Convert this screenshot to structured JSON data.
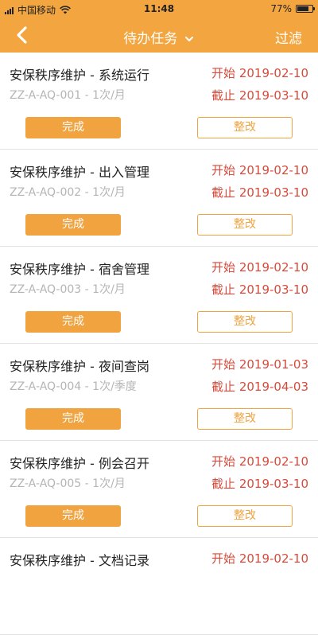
{
  "status_bar": {
    "carrier": "中国移动",
    "time": "11:48",
    "battery_text": "77%",
    "battery_level": 0.77
  },
  "navbar": {
    "title": "待办任务",
    "filter_label": "过滤"
  },
  "colors": {
    "accent": "#f3a640",
    "date_red": "#d84a3b",
    "code_gray": "#b5b5b5"
  },
  "tasks": [
    {
      "name": "安保秩序维护 - 系统运行",
      "code": "ZZ-A-AQ-001 - 1次/月",
      "start": "开始 2019-02-10",
      "end": "截止 2019-03-10",
      "done_label": "完成",
      "fix_label": "整改"
    },
    {
      "name": "安保秩序维护 - 出入管理",
      "code": "ZZ-A-AQ-002 - 1次/月",
      "start": "开始 2019-02-10",
      "end": "截止 2019-03-10",
      "done_label": "完成",
      "fix_label": "整改"
    },
    {
      "name": "安保秩序维护 - 宿舍管理",
      "code": "ZZ-A-AQ-003 - 1次/月",
      "start": "开始 2019-02-10",
      "end": "截止 2019-03-10",
      "done_label": "完成",
      "fix_label": "整改"
    },
    {
      "name": "安保秩序维护 - 夜间查岗",
      "code": "ZZ-A-AQ-004 - 1次/季度",
      "start": "开始 2019-01-03",
      "end": "截止 2019-04-03",
      "done_label": "完成",
      "fix_label": "整改"
    },
    {
      "name": "安保秩序维护 - 例会召开",
      "code": "ZZ-A-AQ-005 - 1次/月",
      "start": "开始 2019-02-10",
      "end": "截止 2019-03-10",
      "done_label": "完成",
      "fix_label": "整改"
    },
    {
      "name": "安保秩序维护 - 文档记录",
      "code": "",
      "start": "开始 2019-02-10",
      "end": "",
      "done_label": "",
      "fix_label": ""
    }
  ]
}
